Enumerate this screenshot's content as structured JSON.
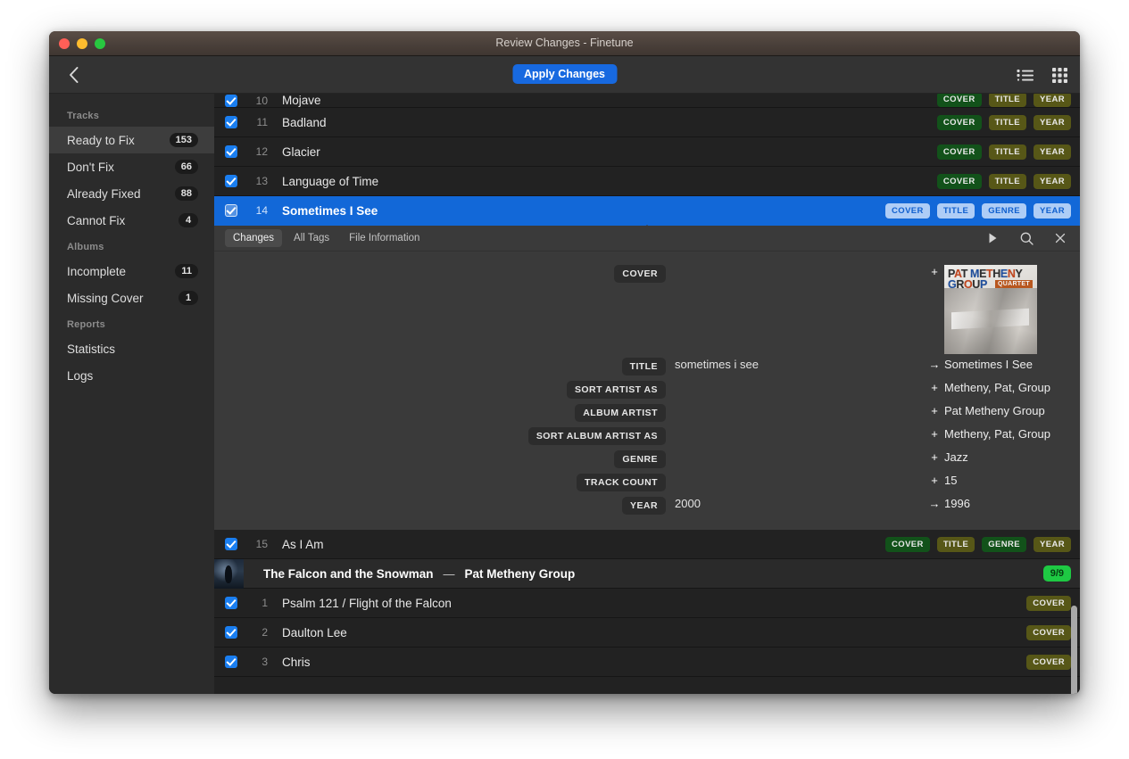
{
  "window": {
    "title": "Review Changes - Finetune",
    "traffic_lights": [
      "close-red",
      "minimize-yellow",
      "maximize-green"
    ]
  },
  "toolbar": {
    "back_icon": "chevron-left-icon",
    "apply_label": "Apply Changes",
    "view_list_icon": "list-view-icon",
    "view_grid_icon": "grid-view-icon"
  },
  "sidebar": {
    "sections": [
      {
        "header": "Tracks",
        "items": [
          {
            "label": "Ready to Fix",
            "count": "153",
            "active": true
          },
          {
            "label": "Don't Fix",
            "count": "66",
            "active": false
          },
          {
            "label": "Already Fixed",
            "count": "88",
            "active": false
          },
          {
            "label": "Cannot Fix",
            "count": "4",
            "active": false
          }
        ]
      },
      {
        "header": "Albums",
        "items": [
          {
            "label": "Incomplete",
            "count": "11",
            "active": false
          },
          {
            "label": "Missing Cover",
            "count": "1",
            "active": false
          }
        ]
      },
      {
        "header": "Reports",
        "items": [
          {
            "label": "Statistics",
            "count": "",
            "active": false
          },
          {
            "label": "Logs",
            "count": "",
            "active": false
          }
        ]
      }
    ]
  },
  "track_rows_top": [
    {
      "num": "10",
      "title": "Mojave",
      "tags": [
        "COVER",
        "TITLE",
        "YEAR"
      ],
      "selected": false,
      "clipped": true
    },
    {
      "num": "11",
      "title": "Badland",
      "tags": [
        "COVER",
        "TITLE",
        "YEAR"
      ],
      "selected": false,
      "clipped": false
    },
    {
      "num": "12",
      "title": "Glacier",
      "tags": [
        "COVER",
        "TITLE",
        "YEAR"
      ],
      "selected": false,
      "clipped": false
    },
    {
      "num": "13",
      "title": "Language of Time",
      "tags": [
        "COVER",
        "TITLE",
        "YEAR"
      ],
      "selected": false,
      "clipped": false
    },
    {
      "num": "14",
      "title": "Sometimes I See",
      "tags": [
        "COVER",
        "TITLE",
        "GENRE",
        "YEAR"
      ],
      "selected": true,
      "clipped": false
    }
  ],
  "detail": {
    "tabs": [
      {
        "label": "Changes",
        "active": true
      },
      {
        "label": "All Tags",
        "active": false
      },
      {
        "label": "File Information",
        "active": false
      }
    ],
    "actions": [
      "play-icon",
      "search-icon",
      "close-icon"
    ],
    "cover": {
      "label": "COVER",
      "sign": "+",
      "art_line1": "PAT METHENY",
      "art_line2": "GROUP",
      "art_badge": "QUARTET"
    },
    "fields": [
      {
        "label": "TITLE",
        "old": "sometimes i see",
        "sign": "→",
        "new": "Sometimes I See"
      },
      {
        "label": "SORT ARTIST AS",
        "old": "",
        "sign": "+",
        "new": "Metheny, Pat, Group"
      },
      {
        "label": "ALBUM ARTIST",
        "old": "",
        "sign": "+",
        "new": "Pat Metheny Group"
      },
      {
        "label": "SORT ALBUM ARTIST AS",
        "old": "",
        "sign": "+",
        "new": "Metheny, Pat, Group"
      },
      {
        "label": "GENRE",
        "old": "",
        "sign": "+",
        "new": "Jazz"
      },
      {
        "label": "TRACK COUNT",
        "old": "",
        "sign": "+",
        "new": "15"
      },
      {
        "label": "YEAR",
        "old": "2000",
        "sign": "→",
        "new": "1996"
      }
    ]
  },
  "track_rows_bottom": [
    {
      "num": "15",
      "title": "As I Am",
      "tags": [
        "COVER",
        "TITLE",
        "GENRE",
        "YEAR"
      ]
    }
  ],
  "album_group": {
    "album": "The Falcon and the Snowman",
    "separator": "—",
    "artist": "Pat Metheny Group",
    "count": "9/9"
  },
  "album_tracks": [
    {
      "num": "1",
      "title": "Psalm 121 / Flight of the Falcon",
      "tags": [
        "COVER"
      ]
    },
    {
      "num": "2",
      "title": "Daulton Lee",
      "tags": [
        "COVER"
      ]
    },
    {
      "num": "3",
      "title": "Chris",
      "tags": [
        "COVER"
      ]
    }
  ],
  "colors": {
    "accent_blue": "#1769e0",
    "selection_blue": "#1268d8",
    "tag_cover_green": "#12521a",
    "tag_olive": "#575717",
    "count_green": "#1ec943"
  }
}
